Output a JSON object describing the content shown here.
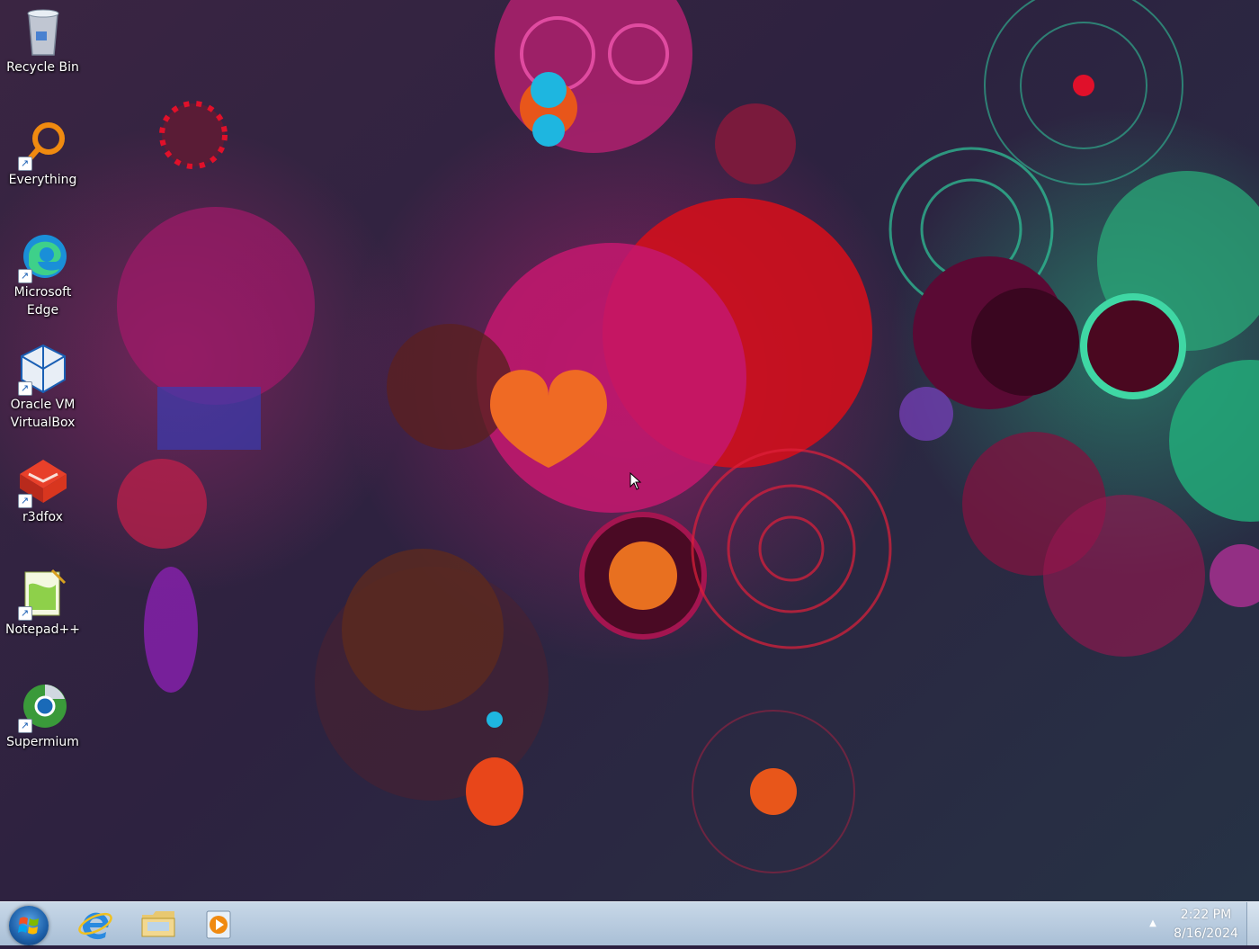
{
  "desktop": {
    "icons": [
      {
        "label": "Recycle Bin",
        "icon": "recycle-bin-icon"
      },
      {
        "label": "Everything",
        "icon": "everything-search-icon"
      },
      {
        "label": "Microsoft Edge",
        "icon": "edge-browser-icon"
      },
      {
        "label": "Oracle VM VirtualBox",
        "icon": "virtualbox-icon"
      },
      {
        "label": "r3dfox",
        "icon": "r3dfox-icon"
      },
      {
        "label": "Notepad++",
        "icon": "notepad-plus-plus-icon"
      },
      {
        "label": "Supermium",
        "icon": "supermium-browser-icon"
      }
    ]
  },
  "taskbar": {
    "pinned": [
      {
        "name": "internet-explorer",
        "icon": "internet-explorer-icon"
      },
      {
        "name": "file-explorer",
        "icon": "folder-icon"
      },
      {
        "name": "media-player",
        "icon": "media-player-icon"
      }
    ],
    "clock": {
      "time": "2:22 PM",
      "date": "8/16/2024"
    },
    "tray_arrow": "▲"
  }
}
